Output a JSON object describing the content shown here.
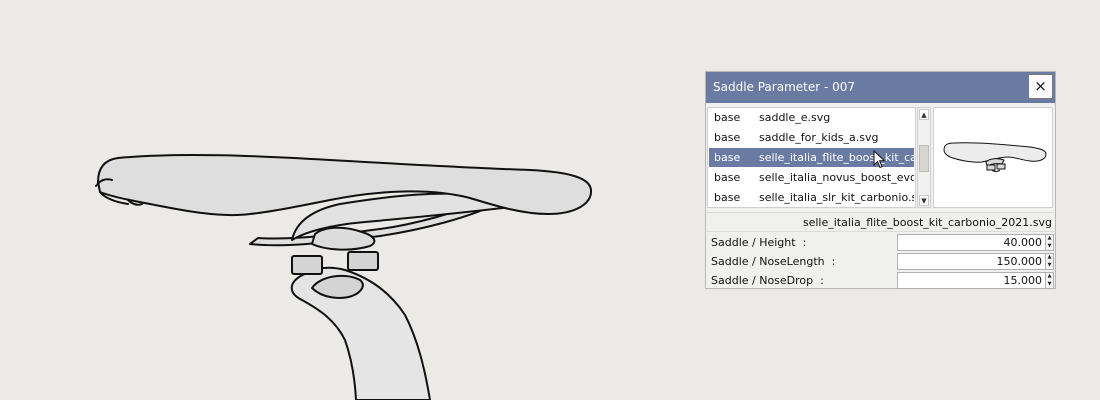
{
  "dialog": {
    "title": "Saddle Parameter - 007",
    "close_label": "×"
  },
  "file_list": {
    "rows": [
      {
        "category": "base",
        "file": "saddle_e.svg",
        "selected": false
      },
      {
        "category": "base",
        "file": "saddle_for_kids_a.svg",
        "selected": false
      },
      {
        "category": "base",
        "file": "selle_italia_flite_boost_kit_car",
        "selected": true
      },
      {
        "category": "base",
        "file": "selle_italia_novus_boost_evo_",
        "selected": false
      },
      {
        "category": "base",
        "file": "selle_italia_slr_kit_carbonio.sv",
        "selected": false
      }
    ]
  },
  "scrollbar": {
    "up": "▲",
    "down": "▼"
  },
  "selected_file": "selle_italia_flite_boost_kit_carbonio_2021.svg",
  "params": [
    {
      "label": "Saddle / Height  :",
      "value": "40.000"
    },
    {
      "label": "Saddle / NoseLength  :",
      "value": "150.000"
    },
    {
      "label": "Saddle / NoseDrop  :",
      "value": "15.000"
    }
  ],
  "spinner": {
    "up": "▲",
    "down": "▼"
  },
  "colors": {
    "background": "#ebeae7",
    "title_bar": "#6a7ba3",
    "selection": "#6a7ba3",
    "saddle_fill": "#dedede",
    "seatpost_fill": "#e5e5e5",
    "outline": "#111111"
  }
}
